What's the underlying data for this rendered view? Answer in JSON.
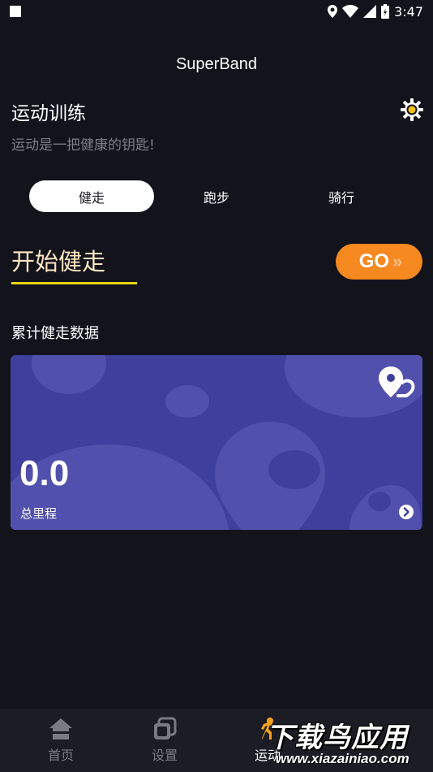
{
  "status_bar": {
    "time": "3:47"
  },
  "app_title": "SuperBand",
  "section": {
    "heading": "运动训练",
    "subtitle": "运动是一把健康的钥匙!"
  },
  "tabs": [
    {
      "label": "健走",
      "active": true
    },
    {
      "label": "跑步",
      "active": false
    },
    {
      "label": "骑行",
      "active": false
    }
  ],
  "start": {
    "title": "开始健走",
    "go_label": "GO",
    "go_arrows": "»"
  },
  "data_section": {
    "heading": "累计健走数据",
    "value": "0.0",
    "label": "总里程"
  },
  "bottom_nav": [
    {
      "label": "首页",
      "icon": "home-icon",
      "active": false
    },
    {
      "label": "设置",
      "icon": "settings-pages-icon",
      "active": false
    },
    {
      "label": "运动",
      "icon": "sport-icon",
      "active": true
    }
  ],
  "watermark": {
    "title": "下载鸟应用",
    "url": "www.xiazainiao.com"
  },
  "colors": {
    "background": "#13131c",
    "card": "#3f3f9d",
    "go_button": "#f6891f",
    "underline": "#e5d711",
    "start_title": "#ffe7c2"
  }
}
